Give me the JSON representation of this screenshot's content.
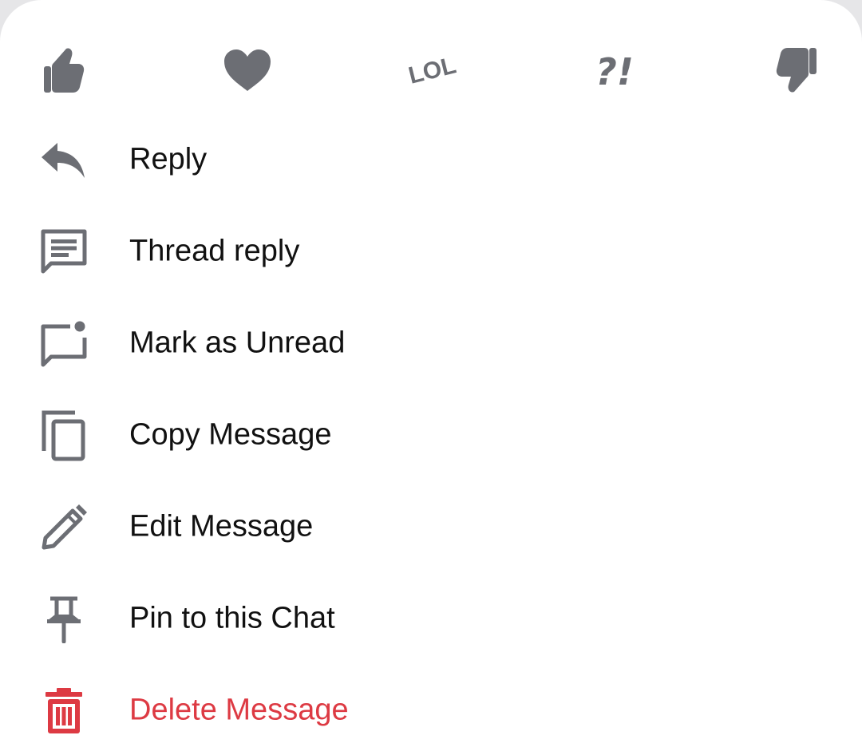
{
  "reactions": [
    {
      "name": "thumbs-up",
      "icon": "thumbs-up-icon"
    },
    {
      "name": "love",
      "icon": "heart-icon"
    },
    {
      "name": "haha",
      "icon": "lol-icon",
      "text": "LOL"
    },
    {
      "name": "wow",
      "icon": "interrobang-icon",
      "text": "?!"
    },
    {
      "name": "thumbs-down",
      "icon": "thumbs-down-icon"
    }
  ],
  "menu": {
    "items": [
      {
        "label": "Reply",
        "icon": "reply-icon"
      },
      {
        "label": "Thread reply",
        "icon": "thread-icon"
      },
      {
        "label": "Mark as Unread",
        "icon": "mark-unread-icon"
      },
      {
        "label": "Copy Message",
        "icon": "copy-icon"
      },
      {
        "label": "Edit Message",
        "icon": "pencil-icon"
      },
      {
        "label": "Pin to this Chat",
        "icon": "pin-icon"
      },
      {
        "label": "Delete Message",
        "icon": "trash-icon",
        "color": "#dd3a43"
      }
    ]
  },
  "colors": {
    "icon": "#6c6e74",
    "text": "#111111",
    "danger": "#dd3a43",
    "background": "#ffffff"
  }
}
